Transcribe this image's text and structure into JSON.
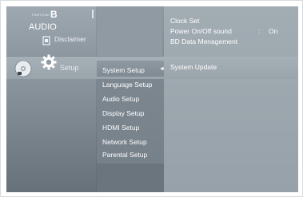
{
  "header": {
    "brand_small": "PANTONE",
    "brand_letter": "B",
    "audio_label": "AUDIO",
    "disclaimer_label": "Disclaimer"
  },
  "info": {
    "clock_set": "Clock Set",
    "power_sound": "Power On/Off sound",
    "power_sound_colon": ":",
    "power_sound_value": "On",
    "bd_data": "BD Data Menagement"
  },
  "nav": {
    "disc_icon": "disc-icon",
    "gear_icon": "gear-icon",
    "setup_label": "Setup",
    "system_setup": "System Setup",
    "system_update": "System Update",
    "left_arrow": "◄",
    "right_arrow": "◄"
  },
  "submenu": {
    "items": [
      "Language Setup",
      "Audio Setup",
      "Display Setup",
      "HDMI Setup",
      "Network Setup",
      "Parental Setup"
    ]
  },
  "colors": {
    "background": "#818c95",
    "highlight": "#a6b0b7",
    "text": "#ffffff"
  }
}
